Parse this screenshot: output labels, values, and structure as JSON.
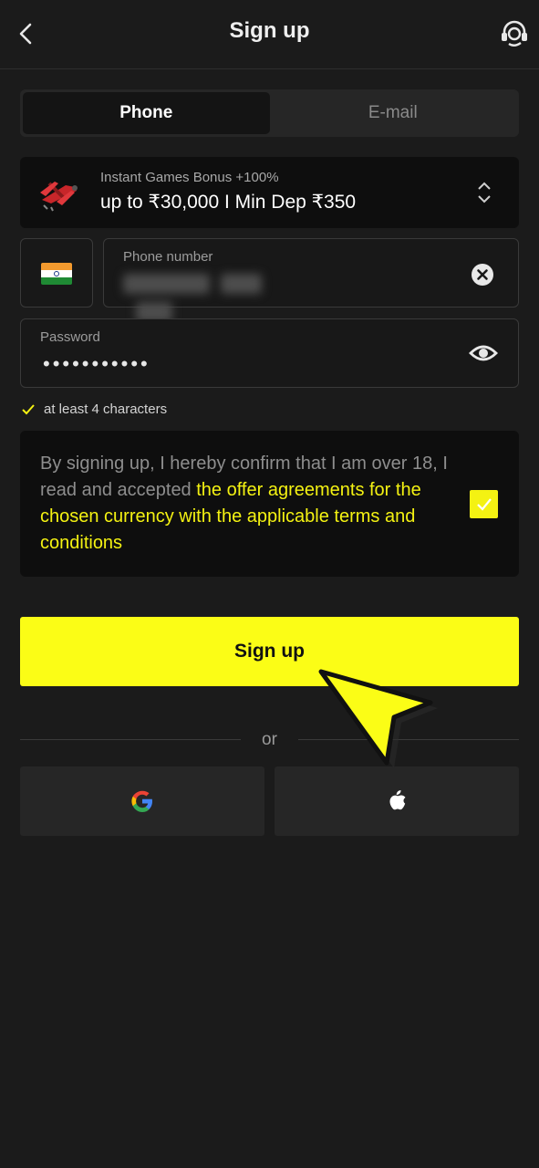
{
  "header": {
    "title": "Sign up",
    "back_icon": "chevron-left-icon",
    "support_icon": "headset-support-icon"
  },
  "tabs": [
    {
      "label": "Phone",
      "active": true
    },
    {
      "label": "E-mail",
      "active": false
    }
  ],
  "bonus": {
    "subtitle": "Instant Games Bonus +100%",
    "main": "up to ₹30,000 I Min Dep ₹350",
    "icon": "biplane-icon"
  },
  "country": {
    "flag": "india-flag-icon"
  },
  "phone": {
    "label": "Phone number",
    "value_hidden": true
  },
  "password": {
    "label": "Password",
    "masked_value": "•••••••••••"
  },
  "hint": "at least 4 characters",
  "consent": {
    "text_plain": "By signing up, I hereby confirm that I am over 18, I read and accepted ",
    "text_link": "the offer agreements for the chosen currency with the applicable terms and conditions",
    "checked": true
  },
  "signup_label": "Sign up",
  "or_label": "or",
  "social": {
    "google_icon": "google-icon",
    "apple_icon": "apple-icon"
  },
  "colors": {
    "accent": "#fbfd16",
    "background": "#1b1b1b",
    "card": "#0e0e0e"
  }
}
